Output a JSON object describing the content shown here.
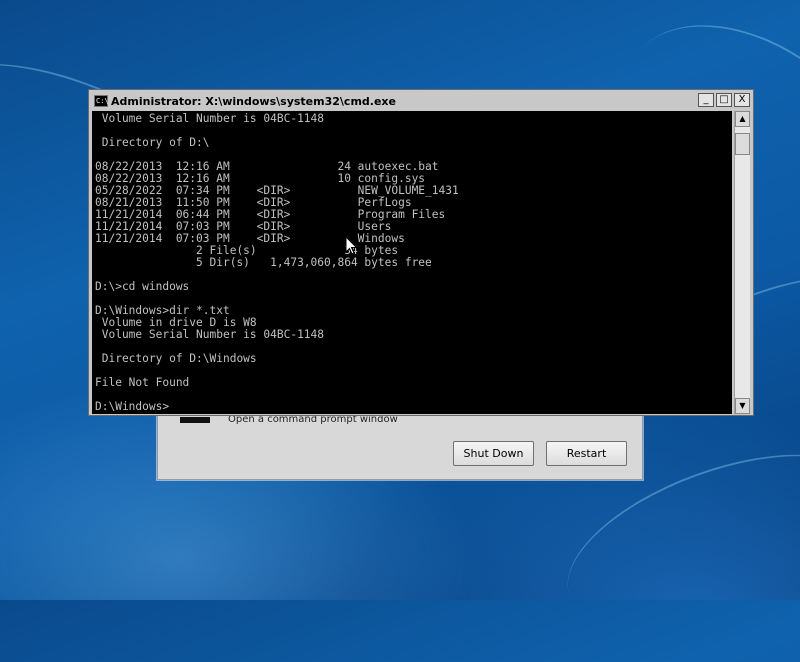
{
  "recovery_dialog": {
    "description": "Open a command prompt window",
    "shutdown_label": "Shut Down",
    "restart_label": "Restart"
  },
  "cmd_window": {
    "title": "Administrator: X:\\windows\\system32\\cmd.exe",
    "icon_text": "C:\\",
    "minimize": "_",
    "maximize": "□",
    "close": "X",
    "scroll_up": "▲",
    "scroll_down": "▼",
    "console_lines": [
      " Volume Serial Number is 04BC-1148",
      "",
      " Directory of D:\\",
      "",
      "08/22/2013  12:16 AM                24 autoexec.bat",
      "08/22/2013  12:16 AM                10 config.sys",
      "05/28/2022  07:34 PM    <DIR>          NEW_VOLUME_1431",
      "08/21/2013  11:50 PM    <DIR>          PerfLogs",
      "11/21/2014  06:44 PM    <DIR>          Program Files",
      "11/21/2014  07:03 PM    <DIR>          Users",
      "11/21/2014  07:03 PM    <DIR>          Windows",
      "               2 File(s)             34 bytes",
      "               5 Dir(s)   1,473,060,864 bytes free",
      "",
      "D:\\>cd windows",
      "",
      "D:\\Windows>dir *.txt",
      " Volume in drive D is W8",
      " Volume Serial Number is 04BC-1148",
      "",
      " Directory of D:\\Windows",
      "",
      "File Not Found",
      "",
      "D:\\Windows>"
    ]
  }
}
